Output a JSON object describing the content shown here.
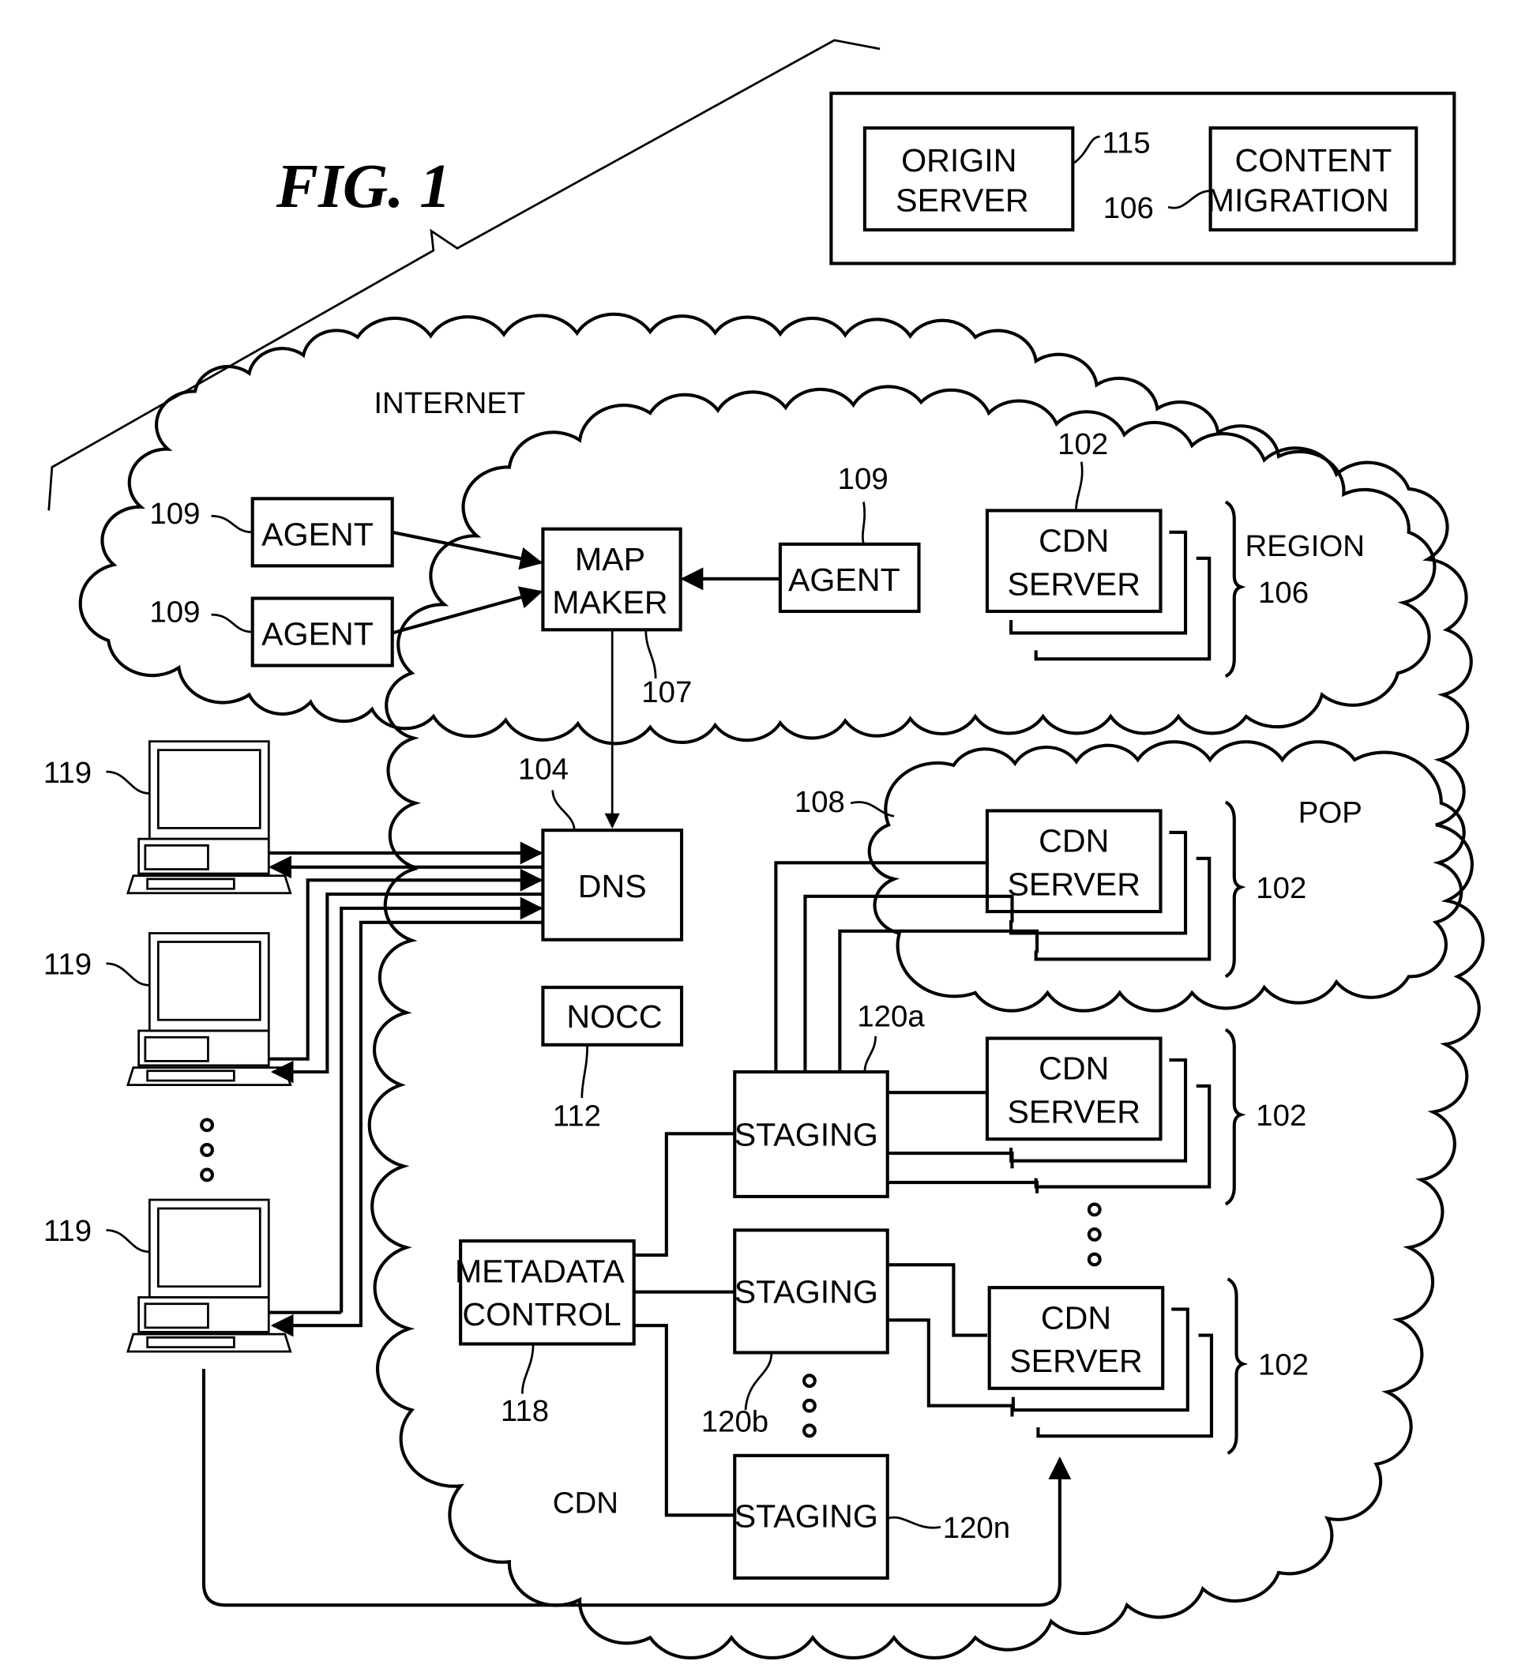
{
  "figure": {
    "title": "FIG.  1"
  },
  "top_box": {
    "origin_server": [
      "ORIGIN",
      "SERVER"
    ],
    "origin_ref": "115",
    "content_migration": [
      "CONTENT",
      "MIGRATION"
    ],
    "content_migration_ref": "106"
  },
  "clouds": {
    "internet": "INTERNET",
    "pop": "POP",
    "cdn": "CDN",
    "region": "REGION",
    "region_ref": "106",
    "pop_ref": "108"
  },
  "agents": [
    {
      "label": "AGENT",
      "ref": "109"
    },
    {
      "label": "AGENT",
      "ref": "109"
    },
    {
      "label": "AGENT",
      "ref": "109"
    }
  ],
  "map_maker": {
    "lines": [
      "MAP",
      "MAKER"
    ],
    "ref": "107"
  },
  "dns": {
    "label": "DNS",
    "ref": "104"
  },
  "nocc": {
    "label": "NOCC",
    "ref": "112"
  },
  "metadata": {
    "lines": [
      "METADATA",
      "CONTROL"
    ],
    "ref": "118"
  },
  "staging": [
    {
      "label": "STAGING",
      "ref": "120a"
    },
    {
      "label": "STAGING",
      "ref": "120b"
    },
    {
      "label": "STAGING",
      "ref": "120n"
    }
  ],
  "cdn_servers": [
    {
      "lines": [
        "CDN",
        "SERVER"
      ],
      "ref": "102",
      "group_ref": "106"
    },
    {
      "lines": [
        "CDN",
        "SERVER"
      ],
      "ref": "102"
    },
    {
      "lines": [
        "CDN",
        "SERVER"
      ],
      "ref": "102"
    },
    {
      "lines": [
        "CDN",
        "SERVER"
      ],
      "ref": "102"
    }
  ],
  "clients": [
    {
      "ref": "119"
    },
    {
      "ref": "119"
    },
    {
      "ref": "119"
    }
  ]
}
